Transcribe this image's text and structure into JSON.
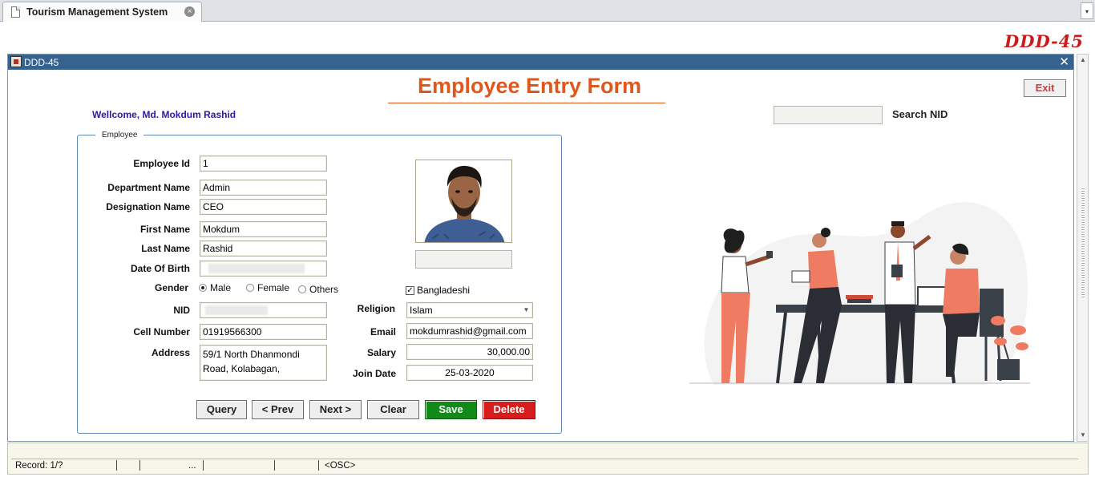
{
  "browser": {
    "tab_title": "Tourism Management System",
    "tab_close": "×",
    "menu_arrow": "▾"
  },
  "header": {
    "logo": "DDD-45"
  },
  "window": {
    "title": "DDD-45",
    "close": "✕",
    "form_title": "Employee Entry Form",
    "exit_label": "Exit",
    "welcome": "Wellcome, Md. Mokdum Rashid",
    "search_label": "Search NID",
    "search_value": ""
  },
  "employee": {
    "legend": "Employee",
    "labels": {
      "employee_id": "Employee Id",
      "department": "Department Name",
      "designation": "Designation Name",
      "first_name": "First Name",
      "last_name": "Last Name",
      "dob": "Date Of Birth",
      "gender": "Gender",
      "nid": "NID",
      "cell": "Cell Number",
      "address": "Address",
      "religion": "Religion",
      "email": "Email",
      "salary": "Salary",
      "join_date": "Join Date"
    },
    "values": {
      "employee_id": "1",
      "department": "Admin",
      "designation": "CEO",
      "first_name": "Mokdum",
      "last_name": "Rashid",
      "cell": "01919566300",
      "address_line1": "59/1 North Dhanmondi",
      "address_line2": "Road, Kolabagan,",
      "religion": "Islam",
      "email": "mokdumrashid@gmail.com",
      "salary": "30,000.00",
      "join_date": "25-03-2020"
    },
    "gender_options": [
      "Male",
      "Female",
      "Others"
    ],
    "gender_selected": "Male",
    "nationality_label": "Bangladeshi",
    "nationality_checked": true
  },
  "buttons": {
    "query": "Query",
    "prev": "<  Prev",
    "next": "Next  >",
    "clear": "Clear",
    "save": "Save",
    "delete": "Delete"
  },
  "colors": {
    "title": "#e0571c",
    "save": "#118a1a",
    "delete": "#d81c1c",
    "window_bar": "#36628f",
    "welcome": "#2a1aa8"
  },
  "status": {
    "record": "Record: 1/?",
    "ellipsis": "...",
    "mode": "<OSC>"
  }
}
